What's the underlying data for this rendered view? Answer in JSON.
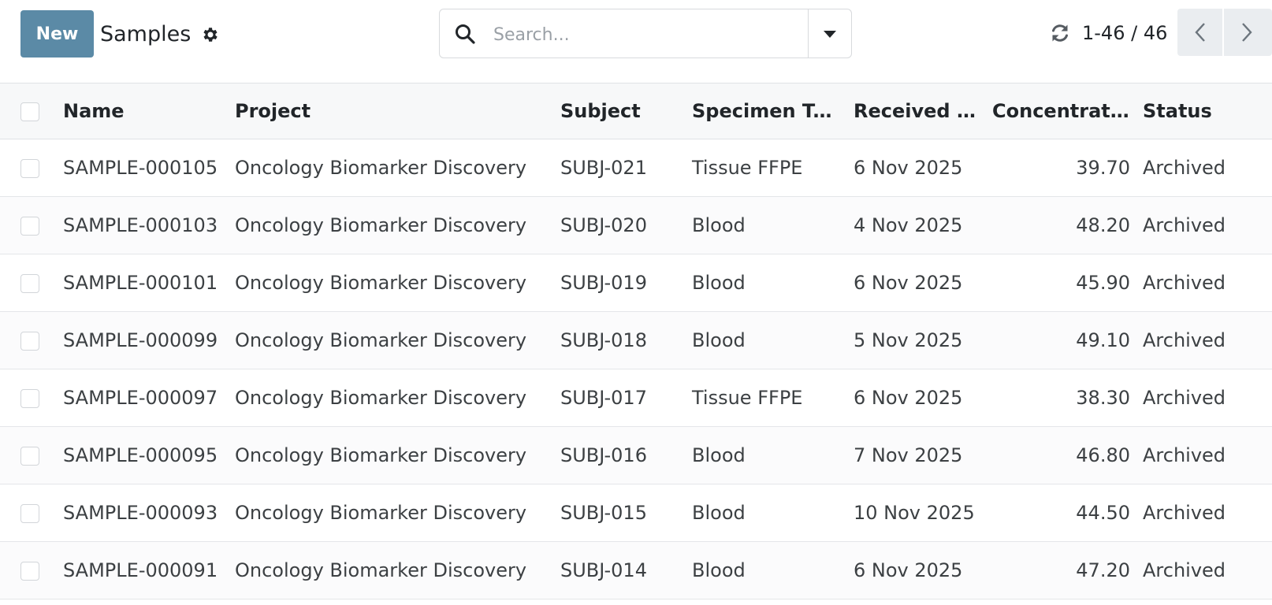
{
  "header": {
    "new_label": "New",
    "title": "Samples",
    "search_placeholder": "Search...",
    "pager": "1-46 / 46"
  },
  "icons": {
    "settings": "gear-icon",
    "search": "search-icon",
    "filter_toggle": "caret-down-icon",
    "refresh": "refresh-icon",
    "prev": "chevron-left-icon",
    "next": "chevron-right-icon"
  },
  "colors": {
    "primary": "#5b8aa6",
    "header_bg": "#f7f8f9"
  },
  "table": {
    "columns": [
      "Name",
      "Project",
      "Subject",
      "Specimen Type",
      "Received D...",
      "Concentrati...",
      "Status"
    ],
    "rows": [
      {
        "name": "SAMPLE-000105",
        "project": "Oncology Biomarker Discovery",
        "subject": "SUBJ-021",
        "specimen": "Tissue FFPE",
        "received": "6 Nov 2025",
        "concentration": "39.70",
        "status": "Archived"
      },
      {
        "name": "SAMPLE-000103",
        "project": "Oncology Biomarker Discovery",
        "subject": "SUBJ-020",
        "specimen": "Blood",
        "received": "4 Nov 2025",
        "concentration": "48.20",
        "status": "Archived"
      },
      {
        "name": "SAMPLE-000101",
        "project": "Oncology Biomarker Discovery",
        "subject": "SUBJ-019",
        "specimen": "Blood",
        "received": "6 Nov 2025",
        "concentration": "45.90",
        "status": "Archived"
      },
      {
        "name": "SAMPLE-000099",
        "project": "Oncology Biomarker Discovery",
        "subject": "SUBJ-018",
        "specimen": "Blood",
        "received": "5 Nov 2025",
        "concentration": "49.10",
        "status": "Archived"
      },
      {
        "name": "SAMPLE-000097",
        "project": "Oncology Biomarker Discovery",
        "subject": "SUBJ-017",
        "specimen": "Tissue FFPE",
        "received": "6 Nov 2025",
        "concentration": "38.30",
        "status": "Archived"
      },
      {
        "name": "SAMPLE-000095",
        "project": "Oncology Biomarker Discovery",
        "subject": "SUBJ-016",
        "specimen": "Blood",
        "received": "7 Nov 2025",
        "concentration": "46.80",
        "status": "Archived"
      },
      {
        "name": "SAMPLE-000093",
        "project": "Oncology Biomarker Discovery",
        "subject": "SUBJ-015",
        "specimen": "Blood",
        "received": "10 Nov 2025",
        "concentration": "44.50",
        "status": "Archived"
      },
      {
        "name": "SAMPLE-000091",
        "project": "Oncology Biomarker Discovery",
        "subject": "SUBJ-014",
        "specimen": "Blood",
        "received": "6 Nov 2025",
        "concentration": "47.20",
        "status": "Archived"
      }
    ]
  }
}
